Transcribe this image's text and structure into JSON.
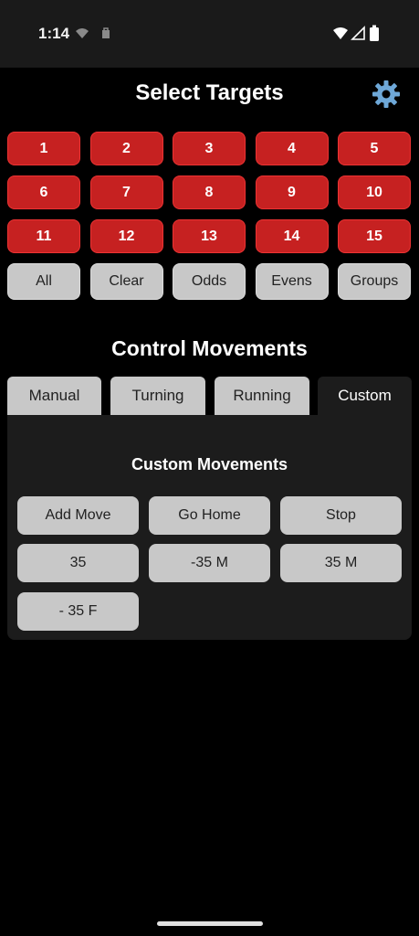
{
  "status": {
    "time": "1:14"
  },
  "header": {
    "title": "Select Targets",
    "settings_icon": "gear-icon"
  },
  "targets": {
    "numbers": [
      "1",
      "2",
      "3",
      "4",
      "5",
      "6",
      "7",
      "8",
      "9",
      "10",
      "11",
      "12",
      "13",
      "14",
      "15"
    ],
    "actions": [
      "All",
      "Clear",
      "Odds",
      "Evens",
      "Groups"
    ]
  },
  "control": {
    "title": "Control Movements",
    "tabs": [
      "Manual",
      "Turning",
      "Running",
      "Custom"
    ],
    "active_tab": "Custom"
  },
  "custom": {
    "title": "Custom Movements",
    "buttons": [
      "Add Move",
      "Go Home",
      "Stop",
      "35",
      "-35 M",
      "35 M",
      "- 35 F"
    ]
  },
  "colors": {
    "target_red": "#c62121",
    "button_gray": "#c8c8c8",
    "panel": "#1c1c1c",
    "gear_blue": "#6ea8d8"
  }
}
